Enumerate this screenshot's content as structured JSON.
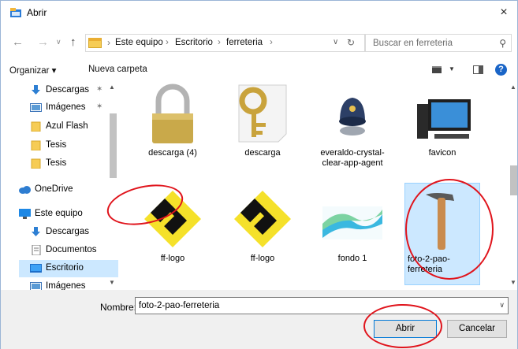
{
  "window": {
    "title": "Abrir",
    "close_glyph": "×"
  },
  "nav": {
    "back": "←",
    "forward": "→",
    "history": "∨",
    "up": "↑",
    "breadcrumbs": [
      "Este equipo",
      "Escritorio",
      "ferreteria"
    ],
    "separator": "›",
    "dropdown": "∨",
    "refresh": "↻",
    "search_placeholder": "Buscar en ferreteria",
    "search_icon": "⚲"
  },
  "toolbar": {
    "organize": "Organizar ▾",
    "new_folder": "Nueva carpeta",
    "help": "?"
  },
  "sidebar": {
    "items": [
      {
        "label": "Descargas",
        "icon": "download-icon",
        "pinned": true
      },
      {
        "label": "Imágenes",
        "icon": "pictures-icon",
        "pinned": true
      },
      {
        "label": "Azul Flash",
        "icon": "folder-icon",
        "pinned": false
      },
      {
        "label": "Tesis",
        "icon": "folder-icon",
        "pinned": false
      },
      {
        "label": "Tesis",
        "icon": "folder-icon",
        "pinned": false
      },
      {
        "label": "OneDrive",
        "icon": "cloud-icon",
        "pinned": false
      },
      {
        "label": "Este equipo",
        "icon": "computer-icon",
        "pinned": false
      },
      {
        "label": "Descargas",
        "icon": "download-icon",
        "pinned": false
      },
      {
        "label": "Documentos",
        "icon": "documents-icon",
        "pinned": false
      },
      {
        "label": "Escritorio",
        "icon": "desktop-icon",
        "pinned": false,
        "selected": true
      },
      {
        "label": "Imágenes",
        "icon": "pictures-icon",
        "pinned": false
      }
    ],
    "pin_glyph": "✶"
  },
  "files": [
    {
      "label": "descarga (4)",
      "thumb": "padlock"
    },
    {
      "label": "descarga",
      "thumb": "key"
    },
    {
      "label": "everaldo-crystal-clear-app-agent",
      "thumb": "agent"
    },
    {
      "label": "favicon",
      "thumb": "computer"
    },
    {
      "label": "ff-logo",
      "thumb": "fflogo"
    },
    {
      "label": "ff-logo",
      "thumb": "fflogo"
    },
    {
      "label": "fondo 1",
      "thumb": "wave"
    },
    {
      "label": "foto-2-pao-ferreteria",
      "thumb": "hammer",
      "selected": true
    }
  ],
  "bottom": {
    "name_label": "Nombre:",
    "name_value": "foto-2-pao-ferreteria",
    "open_button": "Abrir",
    "cancel_button": "Cancelar"
  },
  "colors": {
    "accent": "#0078d7",
    "selection": "#cce8ff",
    "annotation": "#e0141c",
    "folder": "#f6cc55"
  }
}
